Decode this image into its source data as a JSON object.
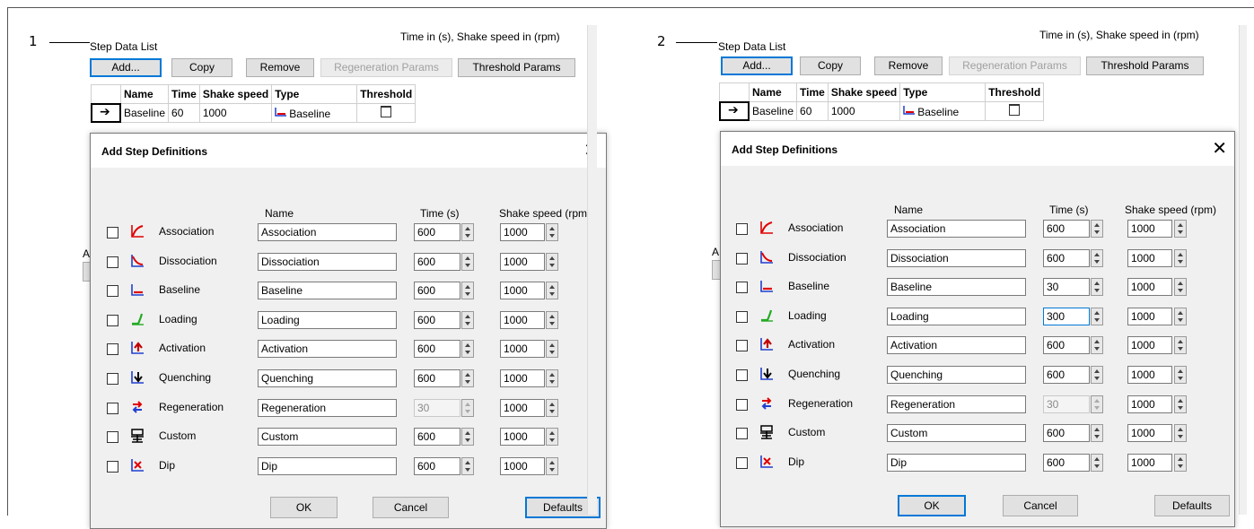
{
  "panels": [
    {
      "callout": "1",
      "group_label": "Step Data List",
      "units_note": "Time in (s), Shake speed in (rpm)",
      "buttons": [
        "Add...",
        "Copy",
        "Remove",
        "Regeneration Params",
        "Threshold Params"
      ],
      "table": {
        "headers": [
          "Name",
          "Time",
          "Shake speed",
          "Type",
          "Threshold"
        ],
        "row": {
          "name": "Baseline",
          "time": "60",
          "shake": "1000",
          "type": "Baseline"
        }
      },
      "dialog": {
        "title": "Add Step Definitions",
        "col_name": "Name",
        "col_time": "Time (s)",
        "col_shake": "Shake speed (rpm)",
        "steps": [
          {
            "label": "Association",
            "name": "Association",
            "time": "600",
            "shake": "1000",
            "icon": "association-icon"
          },
          {
            "label": "Dissociation",
            "name": "Dissociation",
            "time": "600",
            "shake": "1000",
            "icon": "dissociation-icon"
          },
          {
            "label": "Baseline",
            "name": "Baseline",
            "time": "600",
            "shake": "1000",
            "icon": "baseline-icon"
          },
          {
            "label": "Loading",
            "name": "Loading",
            "time": "600",
            "shake": "1000",
            "icon": "loading-icon"
          },
          {
            "label": "Activation",
            "name": "Activation",
            "time": "600",
            "shake": "1000",
            "icon": "activation-icon"
          },
          {
            "label": "Quenching",
            "name": "Quenching",
            "time": "600",
            "shake": "1000",
            "icon": "quenching-icon"
          },
          {
            "label": "Regeneration",
            "name": "Regeneration",
            "time": "30",
            "shake": "1000",
            "icon": "regeneration-icon"
          },
          {
            "label": "Custom",
            "name": "Custom",
            "time": "600",
            "shake": "1000",
            "icon": "custom-icon"
          },
          {
            "label": "Dip",
            "name": "Dip",
            "time": "600",
            "shake": "1000",
            "icon": "dip-icon"
          }
        ],
        "ok": "OK",
        "cancel": "Cancel",
        "defaults": "Defaults"
      }
    },
    {
      "callout": "2",
      "group_label": "Step Data List",
      "units_note": "Time in (s), Shake speed in (rpm)",
      "buttons": [
        "Add...",
        "Copy",
        "Remove",
        "Regeneration Params",
        "Threshold Params"
      ],
      "table": {
        "headers": [
          "Name",
          "Time",
          "Shake speed",
          "Type",
          "Threshold"
        ],
        "row": {
          "name": "Baseline",
          "time": "60",
          "shake": "1000",
          "type": "Baseline"
        }
      },
      "dialog": {
        "title": "Add Step Definitions",
        "col_name": "Name",
        "col_time": "Time (s)",
        "col_shake": "Shake speed (rpm)",
        "steps": [
          {
            "label": "Association",
            "name": "Association",
            "time": "600",
            "shake": "1000",
            "icon": "association-icon"
          },
          {
            "label": "Dissociation",
            "name": "Dissociation",
            "time": "600",
            "shake": "1000",
            "icon": "dissociation-icon"
          },
          {
            "label": "Baseline",
            "name": "Baseline",
            "time": "30",
            "shake": "1000",
            "icon": "baseline-icon"
          },
          {
            "label": "Loading",
            "name": "Loading",
            "time": "300",
            "shake": "1000",
            "icon": "loading-icon"
          },
          {
            "label": "Activation",
            "name": "Activation",
            "time": "600",
            "shake": "1000",
            "icon": "activation-icon"
          },
          {
            "label": "Quenching",
            "name": "Quenching",
            "time": "600",
            "shake": "1000",
            "icon": "quenching-icon"
          },
          {
            "label": "Regeneration",
            "name": "Regeneration",
            "time": "30",
            "shake": "1000",
            "icon": "regeneration-icon"
          },
          {
            "label": "Custom",
            "name": "Custom",
            "time": "600",
            "shake": "1000",
            "icon": "custom-icon"
          },
          {
            "label": "Dip",
            "name": "Dip",
            "time": "600",
            "shake": "1000",
            "icon": "dip-icon"
          }
        ],
        "ok": "OK",
        "cancel": "Cancel",
        "defaults": "Defaults"
      }
    }
  ],
  "colors": {
    "accent": "#0078d7",
    "dialog_bg": "#f0f0f0",
    "icon_red": "#e00000",
    "icon_green": "#22aa22",
    "icon_blue": "#1f3fd0"
  }
}
